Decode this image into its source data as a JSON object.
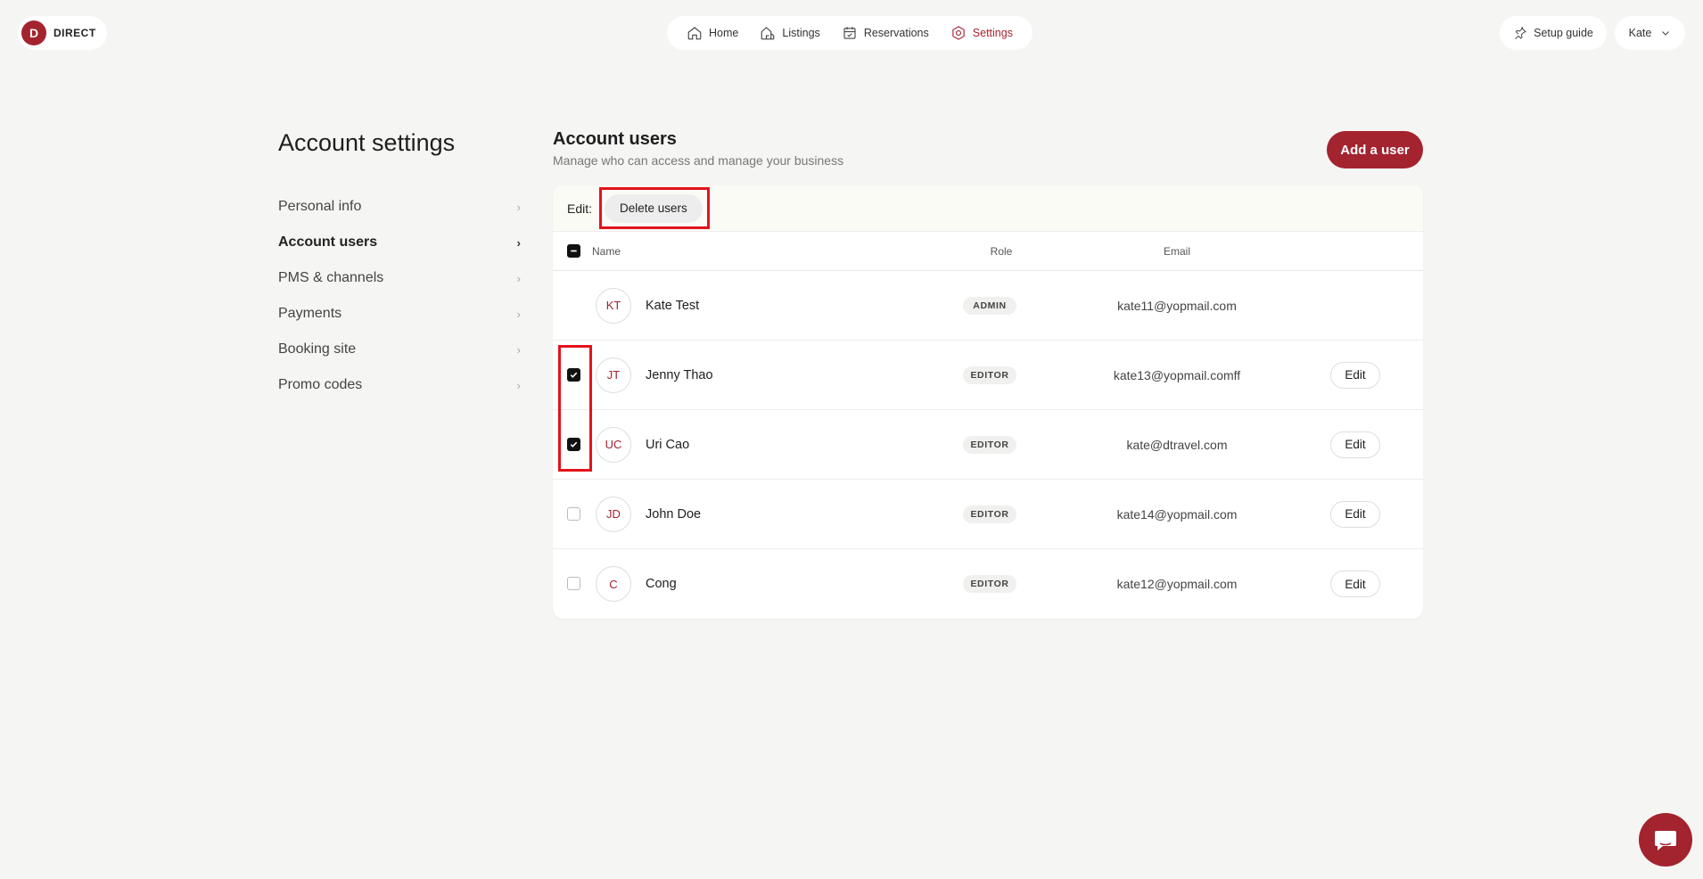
{
  "brand": {
    "logo_letter": "D",
    "name": "DIRECT",
    "accent": "#a3232f"
  },
  "topnav": {
    "items": [
      {
        "label": "Home",
        "icon": "home-icon"
      },
      {
        "label": "Listings",
        "icon": "listings-icon"
      },
      {
        "label": "Reservations",
        "icon": "calendar-check-icon"
      },
      {
        "label": "Settings",
        "icon": "gear-icon",
        "active": true
      }
    ]
  },
  "header_right": {
    "setup_guide": "Setup guide",
    "user_name": "Kate"
  },
  "sidebar": {
    "title": "Account settings",
    "items": [
      {
        "label": "Personal info"
      },
      {
        "label": "Account users",
        "active": true
      },
      {
        "label": "PMS & channels"
      },
      {
        "label": "Payments"
      },
      {
        "label": "Booking site"
      },
      {
        "label": "Promo codes"
      }
    ]
  },
  "main": {
    "title": "Account users",
    "subtitle": "Manage who can access and manage your business",
    "add_user_label": "Add a user",
    "edit_label": "Edit:",
    "delete_users_label": "Delete users",
    "columns": {
      "name": "Name",
      "role": "Role",
      "email": "Email"
    },
    "users": [
      {
        "initials": "KT",
        "name": "Kate Test",
        "role": "ADMIN",
        "email": "kate11@yopmail.com",
        "checkbox": false,
        "checked": false,
        "editable": false
      },
      {
        "initials": "JT",
        "name": "Jenny Thao",
        "role": "EDITOR",
        "email": "kate13@yopmail.comff",
        "checkbox": true,
        "checked": true,
        "editable": true
      },
      {
        "initials": "UC",
        "name": "Uri Cao",
        "role": "EDITOR",
        "email": "kate@dtravel.com",
        "checkbox": true,
        "checked": true,
        "editable": true
      },
      {
        "initials": "JD",
        "name": "John Doe",
        "role": "EDITOR",
        "email": "kate14@yopmail.com",
        "checkbox": true,
        "checked": false,
        "editable": true
      },
      {
        "initials": "C",
        "name": "Cong",
        "role": "EDITOR",
        "email": "kate12@yopmail.com",
        "checkbox": true,
        "checked": false,
        "editable": true
      }
    ],
    "edit_button_label": "Edit"
  }
}
